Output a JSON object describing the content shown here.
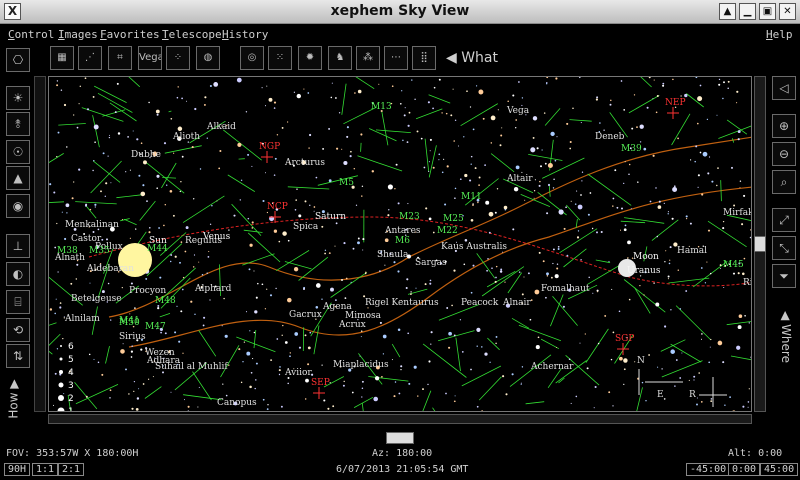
{
  "window": {
    "title": "xephem Sky View",
    "app_icon_glyph": "X"
  },
  "menu": [
    {
      "label": "Control",
      "ul": "C",
      "rest": "ontrol"
    },
    {
      "label": "Images",
      "ul": "I",
      "rest": "mages"
    },
    {
      "label": "Favorites",
      "ul": "F",
      "rest": "avorites"
    },
    {
      "label": "Telescope",
      "ul": "T",
      "rest": "elescope"
    },
    {
      "label": "History",
      "ul": "H",
      "rest": "istory"
    },
    {
      "label": "Help",
      "ul": "H",
      "rest": "elp"
    }
  ],
  "toolbar": {
    "what_label": "What",
    "vega_label": "Vega"
  },
  "side": {
    "how_label": "How",
    "where_label": "Where"
  },
  "magnitude_legend": [
    "6",
    "5",
    "4",
    "3",
    "2",
    "1"
  ],
  "sky_labels": {
    "stars": [
      "Alkaid",
      "Alioth",
      "Dubhe",
      "Arcturus",
      "Vega",
      "Deneb",
      "Altair",
      "Menkalinan",
      "Castor",
      "Pollux",
      "Alnath",
      "Aldebaran",
      "Betelgeuse",
      "Alnilam",
      "Procyon",
      "Regulus",
      "Alphard",
      "Spica",
      "Sirius",
      "Wezen",
      "Adhara",
      "Suhail al Muhlif",
      "Canopus",
      "Aviior",
      "Gacrux",
      "Acrux",
      "Mimosa",
      "Agena",
      "Rigel Kentaurus",
      "Antares",
      "Shaula",
      "Sargas",
      "Kaus Australis",
      "Peacock",
      "Alnair",
      "Fomalhaut",
      "Achernar",
      "Miaplacidus",
      "Hamal",
      "Mirfak",
      "Rigel"
    ],
    "planets": [
      "Sun",
      "Venus",
      "Saturn",
      "Moon",
      "Uranus"
    ],
    "messier": [
      "M13",
      "M5",
      "M23",
      "M25",
      "M22",
      "M11",
      "M6",
      "M39",
      "M38",
      "M44",
      "M35",
      "M41",
      "M50",
      "M47",
      "M48",
      "M45"
    ],
    "poles": [
      "NGP",
      "NEP",
      "SGP",
      "SEP",
      "NCP"
    ],
    "compass": [
      "N",
      "E",
      "R"
    ]
  },
  "status": {
    "fov": "FOV: 353:57W X 180:00H",
    "az": "Az: 180:00",
    "alt": "Alt:   0:00",
    "datetime": "6/07/2013 21:05:54 GMT",
    "lat_box": "90H",
    "zoom1": "1:1",
    "zoom2": "2:1",
    "range_low": "-45:00",
    "range_mid": "0:00",
    "range_high": "45:00"
  },
  "colors": {
    "constellation": "#33dd33",
    "ecliptic": "#dd2222",
    "milkyway": "#c06010",
    "label_star": "#e0e0e0",
    "label_messier": "#55ee55",
    "label_pole": "#ff3333"
  }
}
